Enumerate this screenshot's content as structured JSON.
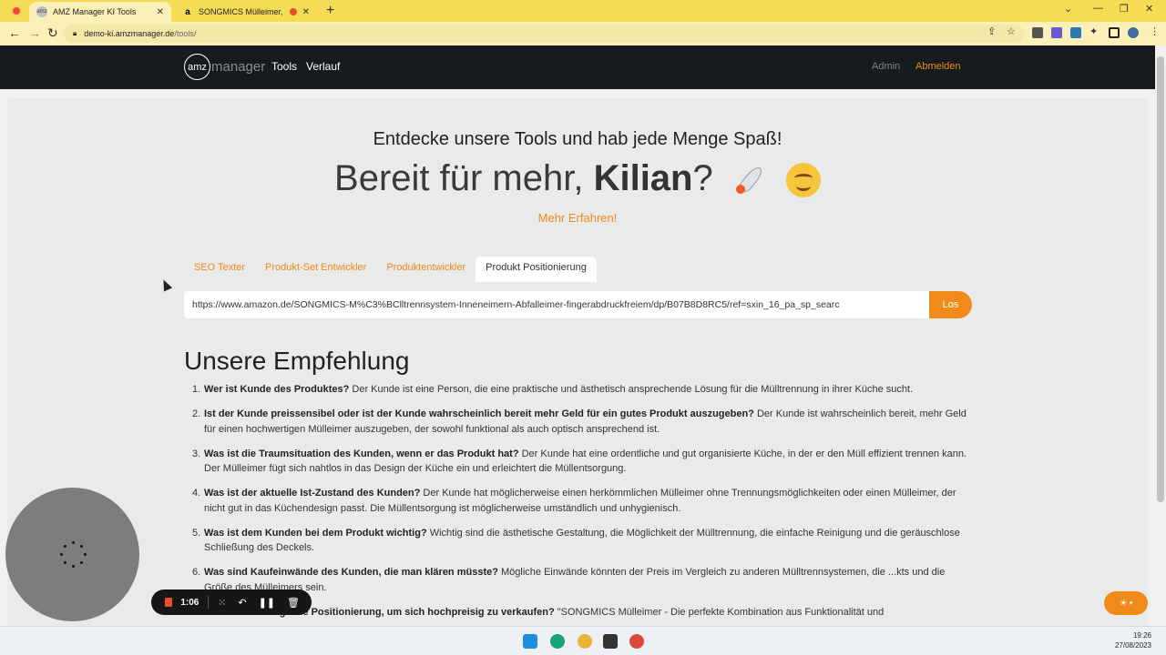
{
  "browser": {
    "tabs": [
      {
        "favicon": "amz",
        "title": "AMZ Manager KI Tools",
        "active": true
      },
      {
        "favicon": "a",
        "title": "SONGMICS Mülleimer, 2 x 3...",
        "active": false
      }
    ],
    "url_host": "demo-ki.amzmanager.de",
    "url_path": "/tools/"
  },
  "navbar": {
    "logo_circle": "amz",
    "logo_text": "manager",
    "links": [
      "Tools",
      "Verlauf"
    ],
    "admin": "Admin",
    "logout": "Abmelden"
  },
  "hero": {
    "subtitle": "Entdecke unsere Tools und hab jede Menge Spaß!",
    "title_prefix": "Bereit für mehr, ",
    "title_name": "Kilian",
    "title_suffix": "?",
    "more_link": "Mehr Erfahren!"
  },
  "tool_tabs": [
    {
      "label": "SEO Texter",
      "active": false
    },
    {
      "label": "Produkt-Set Entwickler",
      "active": false
    },
    {
      "label": "Produktentwickler",
      "active": false
    },
    {
      "label": "Produkt Positionierung",
      "active": true
    }
  ],
  "search": {
    "value": "https://www.amazon.de/SONGMICS-M%C3%BClltrennsystem-Inneneimern-Abfalleimer-fingerabdruckfreiem/dp/B07B8D8RC5/ref=sxin_16_pa_sp_searc",
    "button": "Los"
  },
  "recommendation": {
    "title": "Unsere Empfehlung",
    "items": [
      {
        "num": "1.",
        "question": "Wer ist Kunde des Produktes?",
        "answer": " Der Kunde ist eine Person, die eine praktische und ästhetisch ansprechende Lösung für die Mülltrennung in ihrer Küche sucht."
      },
      {
        "num": "2.",
        "question": "Ist der Kunde preissensibel oder ist der Kunde wahrscheinlich bereit mehr Geld für ein gutes Produkt auszugeben?",
        "answer": " Der Kunde ist wahrscheinlich bereit, mehr Geld für einen hochwertigen Mülleimer auszugeben, der sowohl funktional als auch optisch ansprechend ist."
      },
      {
        "num": "3.",
        "question": "Was ist die Traumsituation des Kunden, wenn er das Produkt hat?",
        "answer": " Der Kunde hat eine ordentliche und gut organisierte Küche, in der er den Müll effizient trennen kann. Der Mülleimer fügt sich nahtlos in das Design der Küche ein und erleichtert die Müllentsorgung."
      },
      {
        "num": "4.",
        "question": "Was ist der aktuelle Ist-Zustand des Kunden?",
        "answer": " Der Kunde hat möglicherweise einen herkömmlichen Mülleimer ohne Trennungsmöglichkeiten oder einen Mülleimer, der nicht gut in das Küchendesign passt. Die Müllentsorgung ist möglicherweise umständlich und unhygienisch."
      },
      {
        "num": "5.",
        "question": "Was ist dem Kunden bei dem Produkt wichtig?",
        "answer": " Wichtig sind die ästhetische Gestaltung, die Möglichkeit der Mülltrennung, die einfache Reinigung und die geräuschlose Schließung des Deckels."
      },
      {
        "num": "6.",
        "question": "Was sind Kaufeinwände des Kunden, die man klären müsste?",
        "answer": " Mögliche Einwände könnten der Preis im Vergleich zu anderen Mülltrennsystemen, die ...kts und die Größe des Mülleimers sein."
      },
      {
        "num": "7.",
        "question": "Was ist eine mögliche Positionierung, um sich hochpreisig zu verkaufen?",
        "answer": " \"SONGMICS Mülleimer - Die perfekte Kombination aus Funktionalität und"
      }
    ]
  },
  "recorder": {
    "time": "1:06"
  },
  "clock": {
    "time": "19:26",
    "date": "27/08/2023"
  },
  "colors": {
    "accent": "#f08a18",
    "navbar": "#161b1d",
    "tabbar": "#f5dc55"
  }
}
